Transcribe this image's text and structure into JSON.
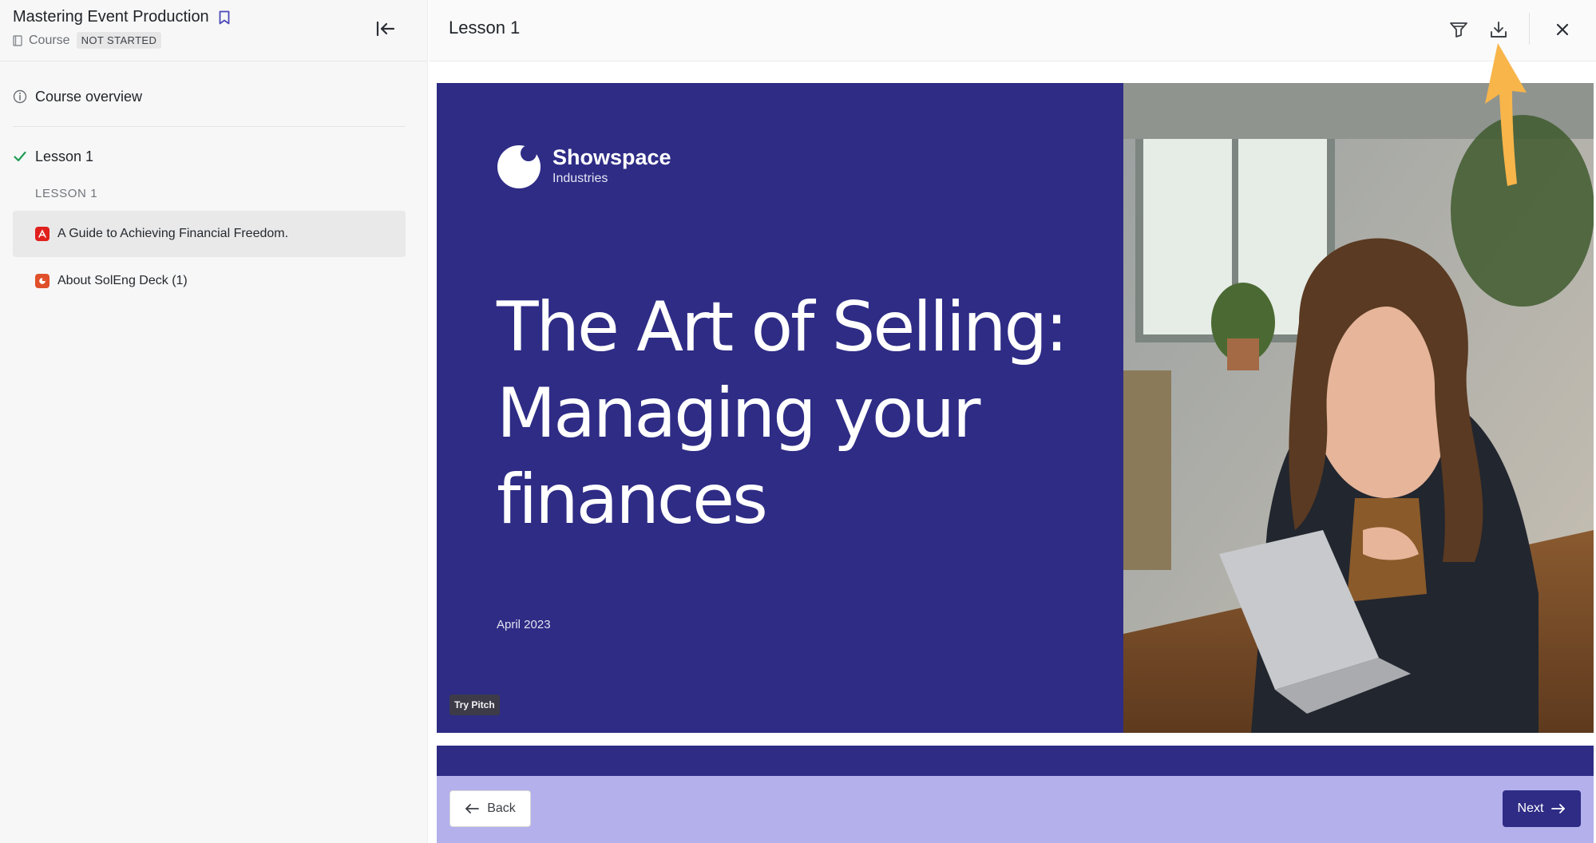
{
  "sidebar": {
    "course_title": "Mastering Event Production",
    "course_type": "Course",
    "status": "NOT STARTED",
    "overview_label": "Course overview",
    "lesson_label": "Lesson 1",
    "section_label": "LESSON 1",
    "items": [
      {
        "label": "A Guide to Achieving Financial Freedom.",
        "icon": "pdf-icon",
        "active": true
      },
      {
        "label": "About SolEng Deck (1)",
        "icon": "presentation-icon",
        "active": false
      }
    ]
  },
  "header": {
    "lesson_title": "Lesson 1",
    "icons": [
      "filter-icon",
      "download-icon",
      "close-icon"
    ]
  },
  "slide": {
    "brand_name": "Showspace",
    "brand_sub": "Industries",
    "title_lines": [
      "The Art of Selling:",
      "Managing your",
      "finances"
    ],
    "date": "April 2023",
    "badge": "Try Pitch"
  },
  "nav": {
    "back_label": "Back",
    "next_label": "Next"
  },
  "colors": {
    "slide_bg": "#2e2c85",
    "bottom_bar": "#b3b0ec",
    "success": "#1f9d55",
    "annotation": "#f8b54a"
  }
}
